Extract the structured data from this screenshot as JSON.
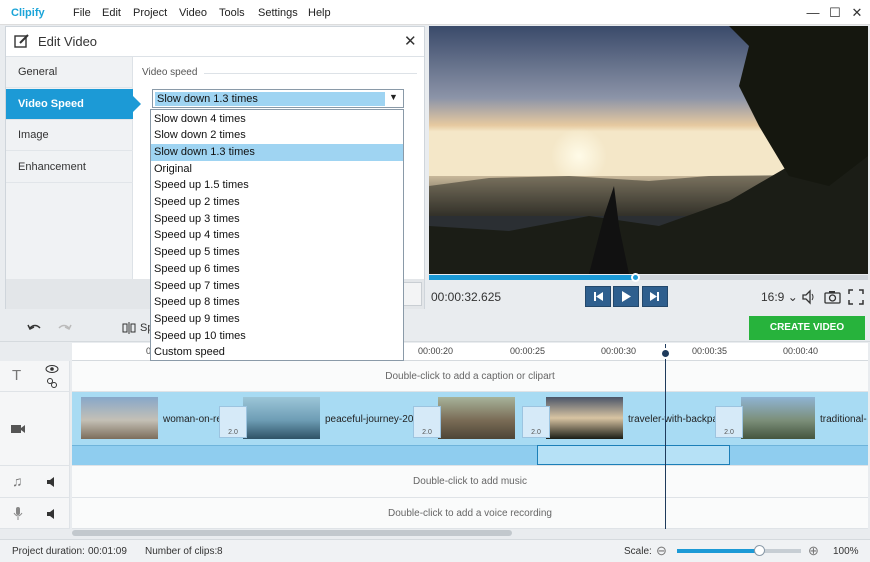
{
  "app": {
    "logo": "Clipify"
  },
  "menu": [
    "File",
    "Edit",
    "Project",
    "Video",
    "Tools",
    "Settings",
    "Help"
  ],
  "panel": {
    "title": "Edit Video",
    "tabs": [
      "General",
      "Video Speed",
      "Image",
      "Enhancement"
    ],
    "active_tab": "Video Speed",
    "section_label": "Video speed",
    "selected_value": "Slow down 1.3 times",
    "options": [
      "Slow down 4 times",
      "Slow down 2 times",
      "Slow down 1.3 times",
      "Original",
      "Speed up 1.5 times",
      "Speed up 2 times",
      "Speed up 3 times",
      "Speed up 4 times",
      "Speed up 5 times",
      "Speed up 6 times",
      "Speed up 7 times",
      "Speed up 8 times",
      "Speed up 9 times",
      "Speed up 10 times",
      "Custom speed"
    ]
  },
  "player": {
    "timecode": "00:00:32.625",
    "aspect": "16:9",
    "progress": 0.47
  },
  "toolbar": {
    "split_label": "Sp",
    "partial_label": "t",
    "create_label": "CREATE VIDEO"
  },
  "ruler": {
    "ticks": [
      "00:00:20",
      "00:00:25",
      "00:00:30",
      "00:00:35",
      "00:00:40"
    ],
    "partial_tick": "0"
  },
  "timeline": {
    "caption_hint": "Double-click to add a caption or clipart",
    "music_hint": "Double-click to add music",
    "voice_hint": "Double-click to add a voice recording",
    "clips": [
      "woman-on-re",
      "peaceful-journey-20",
      "traveler-with-backpa",
      "traditional-"
    ],
    "transition_value": "2.0"
  },
  "status": {
    "duration_label": "Project duration:",
    "duration_value": "00:01:09",
    "clips_label": "Number of clips:",
    "clips_value": "8",
    "scale_label": "Scale:",
    "zoom": "100%"
  },
  "colors": {
    "accent": "#1c9ad6",
    "create": "#27b33c",
    "clip_bg": "#a8dbf3"
  }
}
